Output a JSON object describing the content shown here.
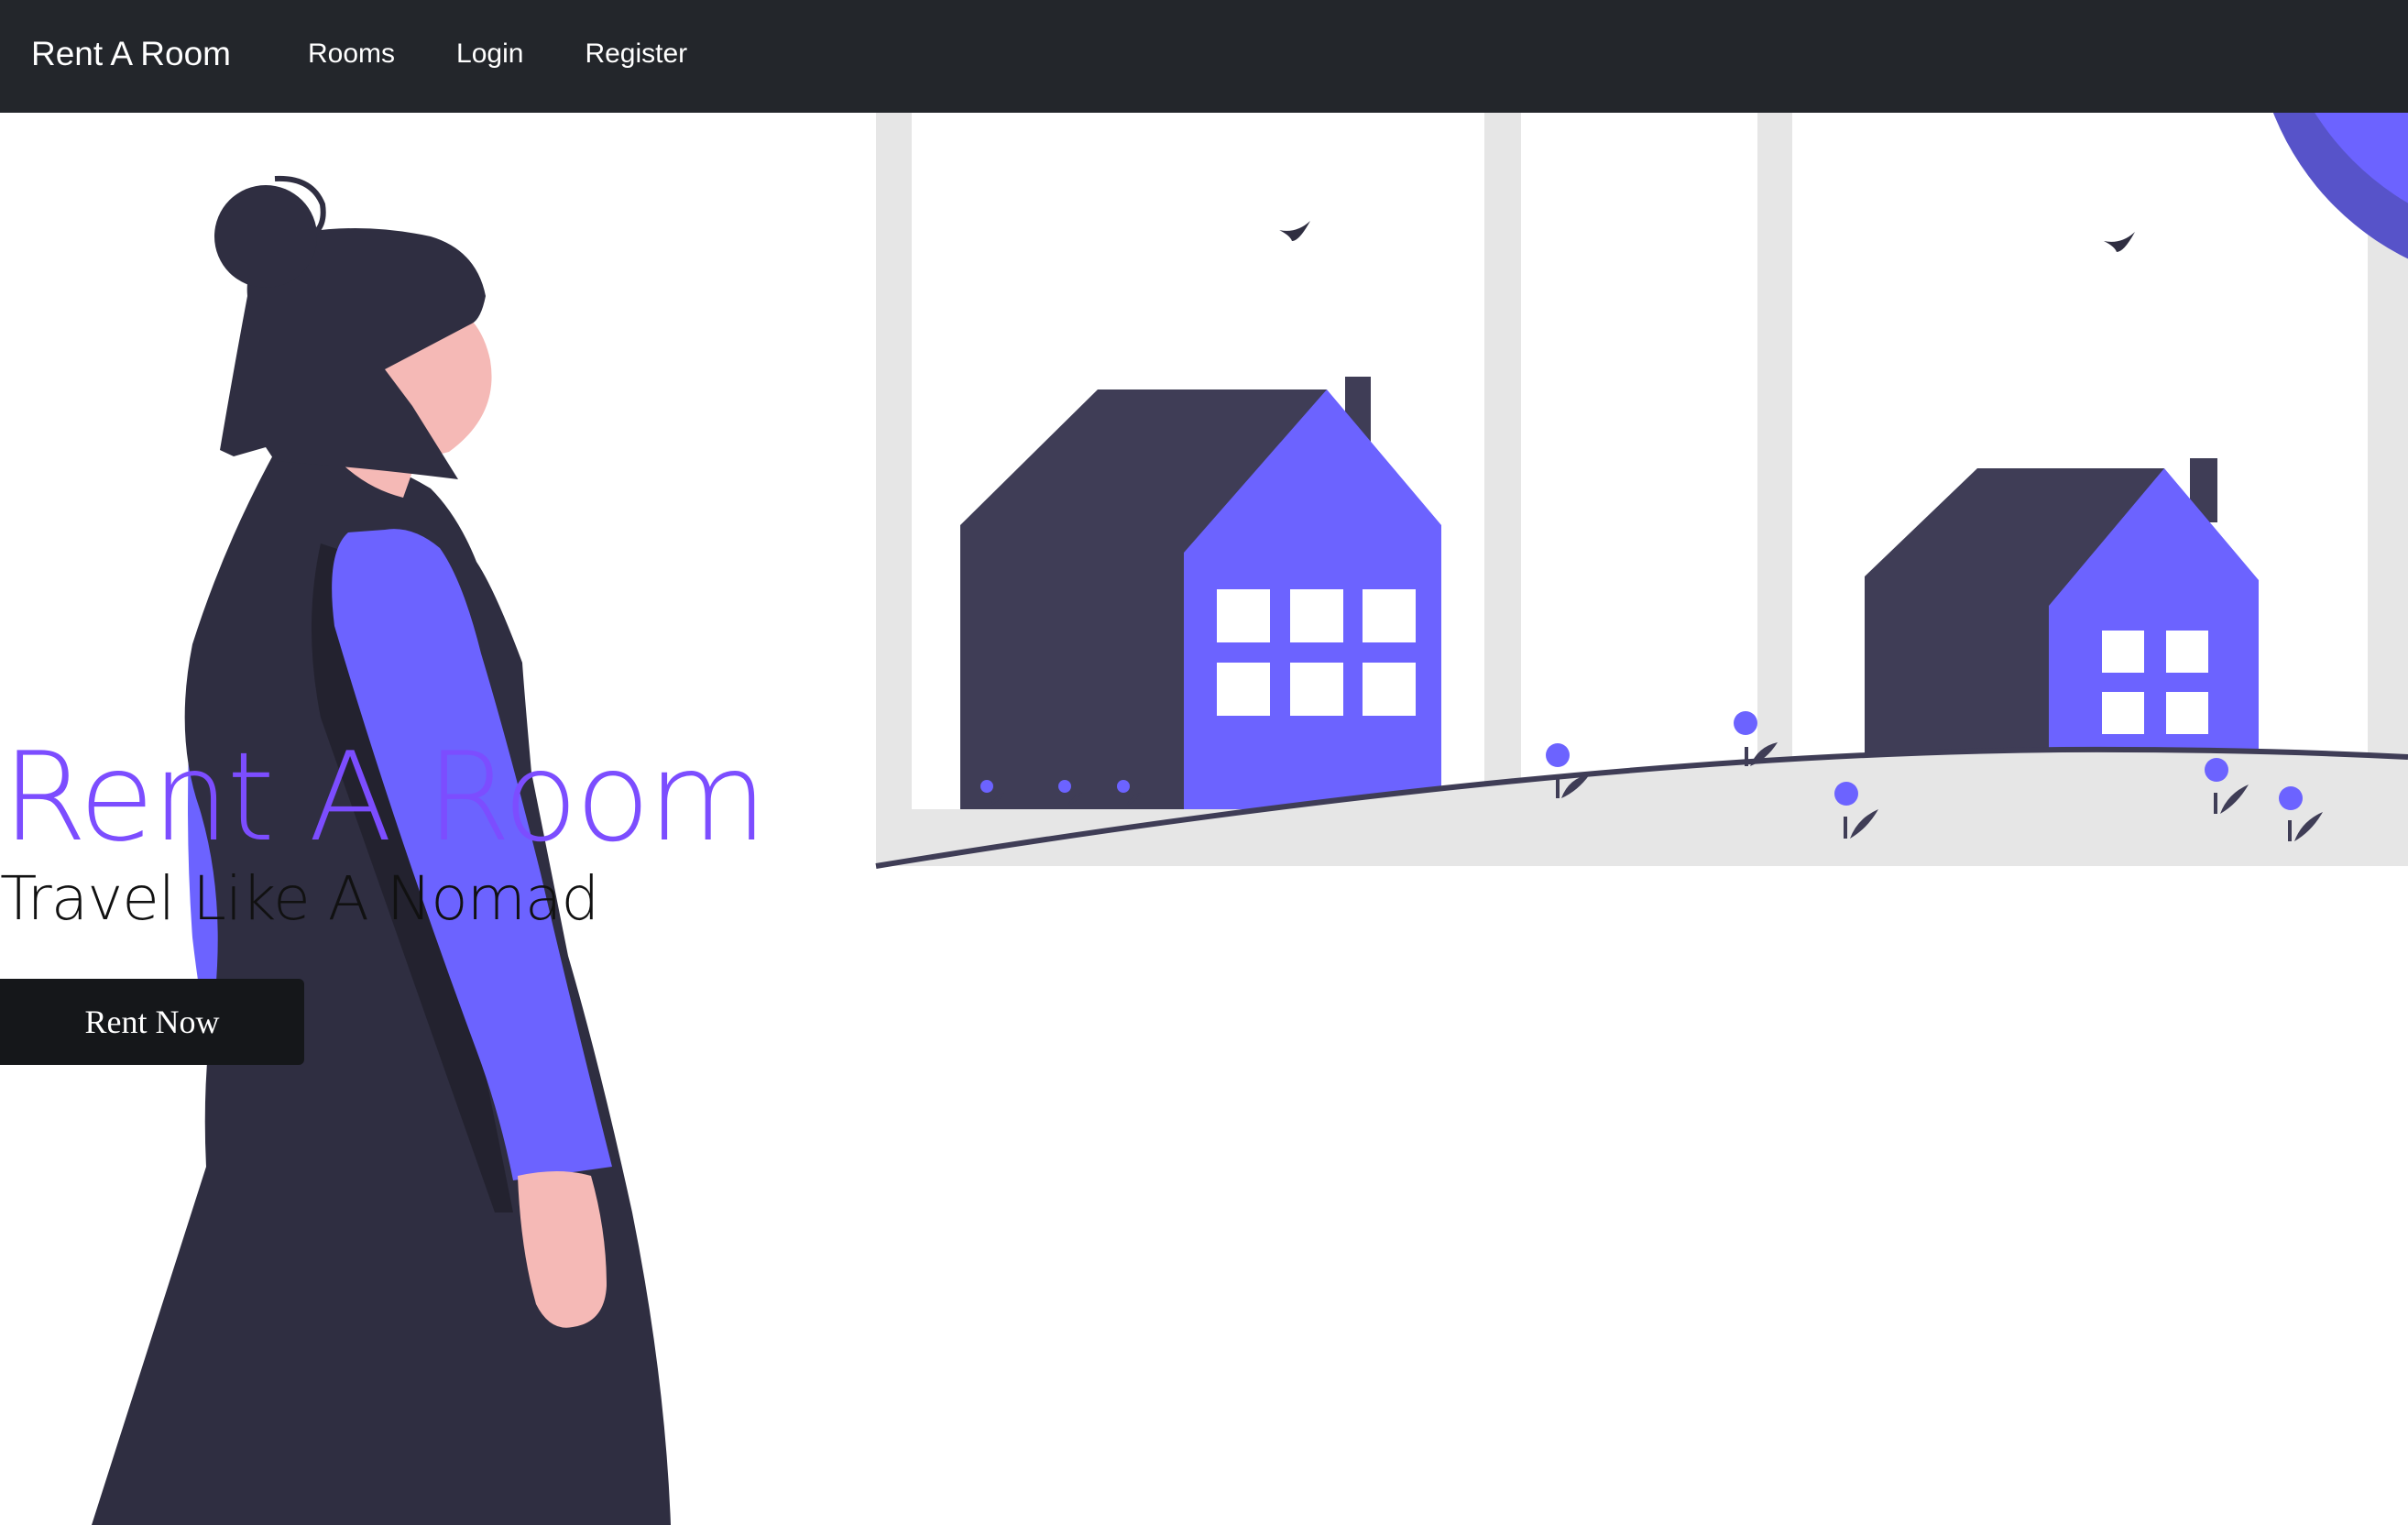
{
  "navbar": {
    "brand": "Rent A Room",
    "links": [
      {
        "label": "Rooms"
      },
      {
        "label": "Login"
      },
      {
        "label": "Register"
      }
    ]
  },
  "hero": {
    "title": "Rent A Room",
    "subtitle": "Travel Like A Nomad",
    "button_label": "Rent Now"
  },
  "colors": {
    "navbar_bg": "#23262b",
    "accent_purple": "#6c63ff",
    "title_purple": "#7c4dff",
    "dark_figure": "#2f2e41",
    "skin": "#f5b9b6",
    "window_frame": "#e6e6e6",
    "button_bg": "#15171a"
  }
}
